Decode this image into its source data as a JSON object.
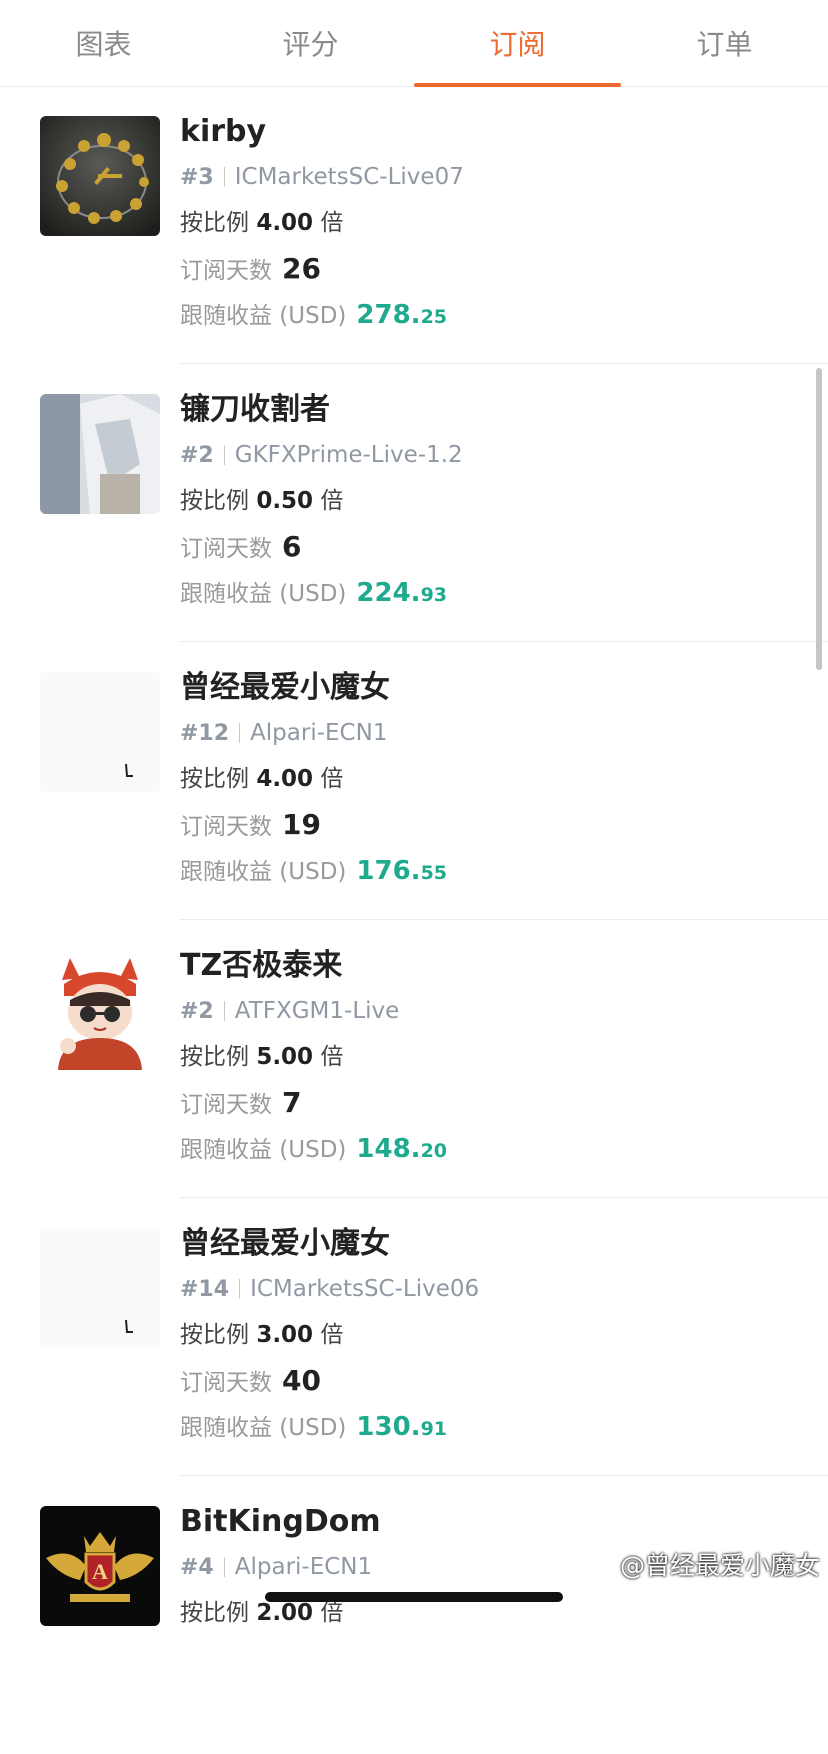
{
  "tabs": [
    {
      "label": "图表",
      "active": false
    },
    {
      "label": "评分",
      "active": false
    },
    {
      "label": "订阅",
      "active": true
    },
    {
      "label": "订单",
      "active": false
    }
  ],
  "labels": {
    "ratio_prefix": "按比例",
    "ratio_suffix": "倍",
    "days": "订阅天数",
    "profit": "跟随收益 (USD)"
  },
  "colors": {
    "accent": "#ef6a2f",
    "profit": "#1fa98d"
  },
  "items": [
    {
      "name": "kirby",
      "rank": "#3",
      "server": "ICMarketsSC-Live07",
      "ratio": "4.00",
      "days": "26",
      "profit_int": "278.",
      "profit_dec": "25",
      "avatar": "gold-clock-icon"
    },
    {
      "name": "镰刀收割者",
      "rank": "#2",
      "server": "GKFXPrime-Live-1.2",
      "ratio": "0.50",
      "days": "6",
      "profit_int": "224.",
      "profit_dec": "93",
      "avatar": "photo-avatar"
    },
    {
      "name": "曾经最爱小魔女",
      "rank": "#12",
      "server": "Alpari-ECN1",
      "ratio": "4.00",
      "days": "19",
      "profit_int": "176.",
      "profit_dec": "55",
      "avatar": "blank-avatar"
    },
    {
      "name": "TZ否极泰来",
      "rank": "#2",
      "server": "ATFXGM1-Live",
      "ratio": "5.00",
      "days": "7",
      "profit_int": "148.",
      "profit_dec": "20",
      "avatar": "cartoon-avatar"
    },
    {
      "name": "曾经最爱小魔女",
      "rank": "#14",
      "server": "ICMarketsSC-Live06",
      "ratio": "3.00",
      "days": "40",
      "profit_int": "130.",
      "profit_dec": "91",
      "avatar": "blank-avatar"
    },
    {
      "name": "BitKingDom",
      "rank": "#4",
      "server": "Alpari-ECN1",
      "ratio": "2.00",
      "days": "",
      "profit_int": "",
      "profit_dec": "",
      "avatar": "crown-emblem-icon"
    }
  ],
  "watermark": "@曾经最爱小魔女"
}
